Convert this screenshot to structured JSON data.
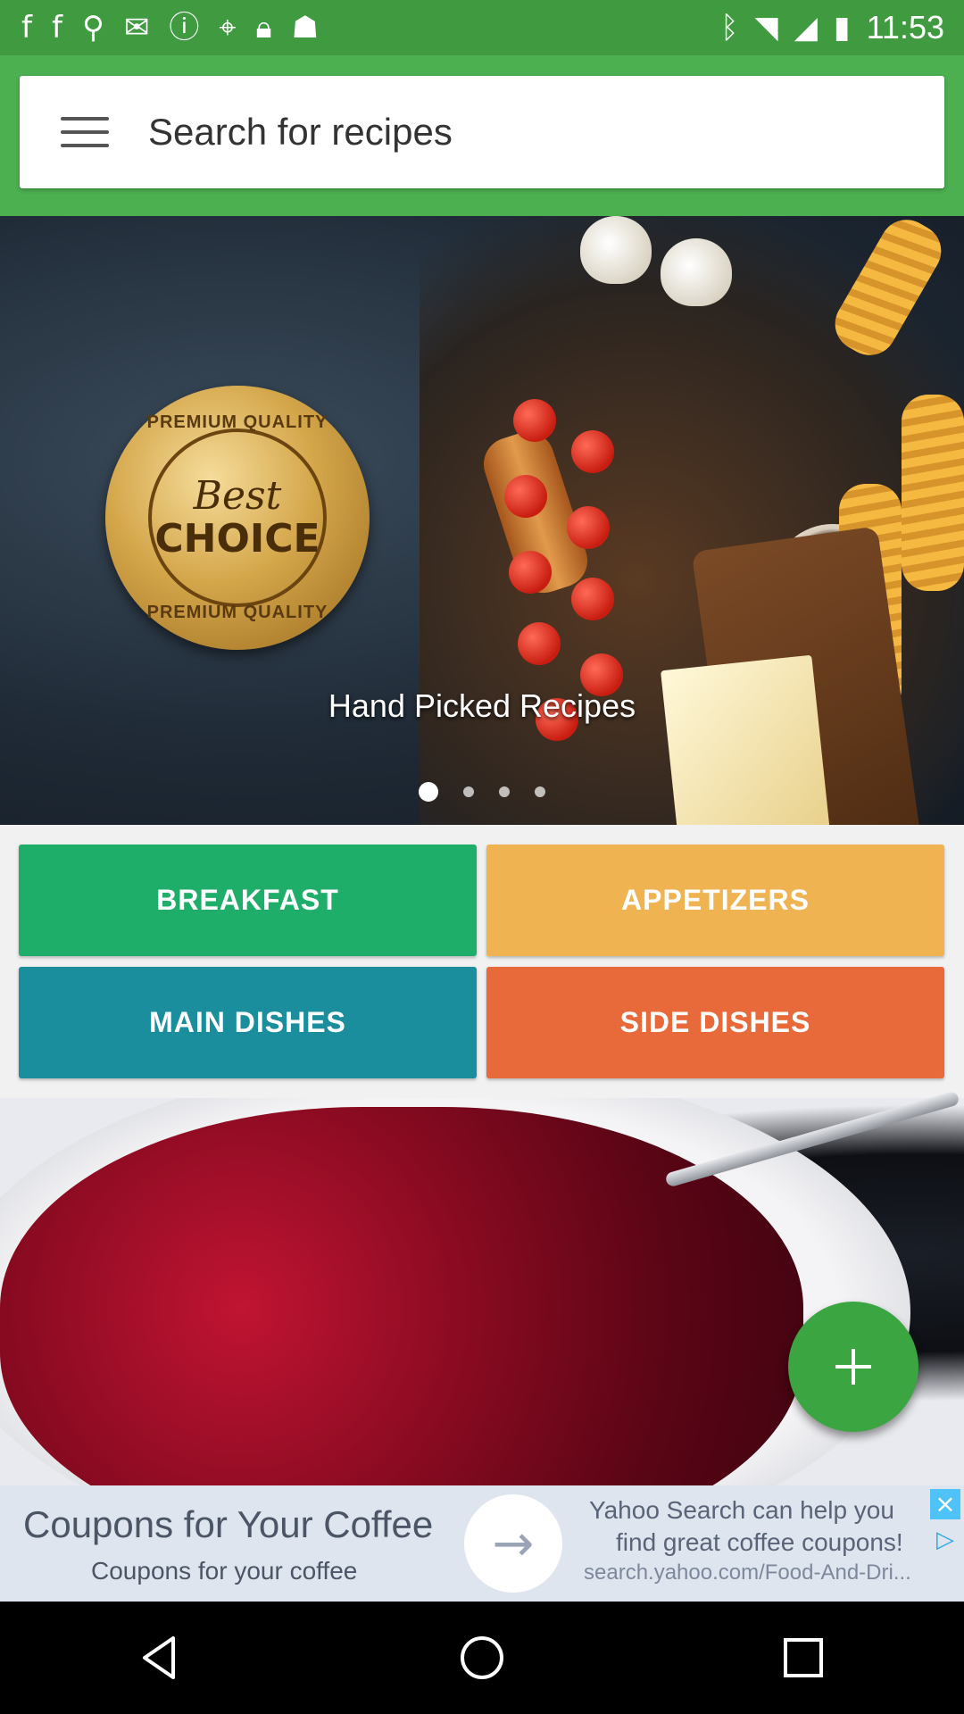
{
  "status_bar": {
    "time": "11:53",
    "icons": [
      "facebook-icon",
      "facebook-icon",
      "pin-icon",
      "mail-icon",
      "alert-icon",
      "location-off-icon",
      "lock-icon",
      "android-icon",
      "bluetooth-icon",
      "wifi-icon",
      "signal-icon",
      "battery-icon"
    ]
  },
  "header": {
    "search_placeholder": "Search for recipes",
    "accent_color": "#4caf50"
  },
  "hero": {
    "caption": "Hand Picked Recipes",
    "badge": {
      "top_text": "PREMIUM QUALITY",
      "best": "Best",
      "choice": "CHOICE",
      "bottom_text": "PREMIUM QUALITY"
    },
    "carousel": {
      "pages": 4,
      "active_index": 0
    }
  },
  "categories": [
    {
      "label": "BREAKFAST",
      "color": "#1fae6a"
    },
    {
      "label": "APPETIZERS",
      "color": "#efb351"
    },
    {
      "label": "MAIN DISHES",
      "color": "#1a8e9c"
    },
    {
      "label": "SIDE DISHES",
      "color": "#e8693a"
    }
  ],
  "fab": {
    "icon": "plus-icon",
    "color": "#3aa541"
  },
  "ad": {
    "title": "Coupons for Your Coffee",
    "subtitle": "Coupons for your coffee",
    "right_line1": "Yahoo Search can help you",
    "right_line2": "find great coffee coupons!",
    "url": "search.yahoo.com/Food-And-Dri..."
  },
  "navbar": {
    "buttons": [
      "back-icon",
      "home-icon",
      "recents-icon"
    ]
  }
}
